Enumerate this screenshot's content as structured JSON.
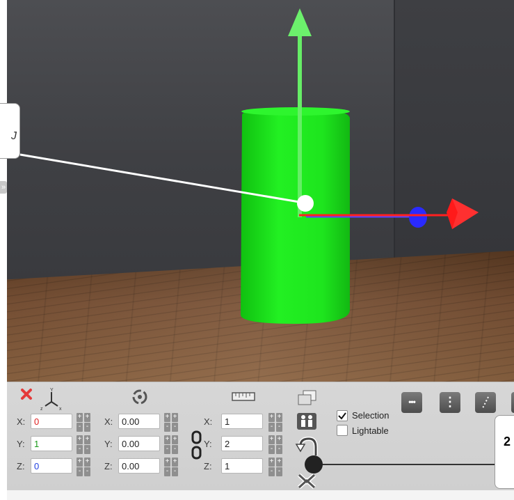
{
  "viewport": {
    "object_color": "#1ee51e",
    "gizmo": {
      "y_axis_color": "#66ff66",
      "x_axis_color": "#ff2020",
      "z_axis_color": "#2a2aff"
    },
    "callout_glyph": "J",
    "panel_toggle_glyph": "»"
  },
  "toolbar": {
    "position": {
      "x_label": "X:",
      "x_value": "0",
      "y_label": "Y:",
      "y_value": "1",
      "z_label": "Z:",
      "z_value": "0",
      "axis_icon_labels": {
        "y": "Y",
        "z": "z",
        "x": "x"
      },
      "x_color": "#e02020",
      "y_color": "#1a9a1a",
      "z_color": "#2040e0"
    },
    "rotation": {
      "x_label": "X:",
      "x_value": "0.00",
      "y_label": "Y:",
      "y_value": "0.00",
      "z_label": "Z:",
      "z_value": "0.00"
    },
    "scale": {
      "x_label": "X:",
      "x_value": "1",
      "y_label": "Y:",
      "y_value": "2",
      "z_label": "Z:",
      "z_value": "1"
    },
    "stepper": {
      "plus": "+",
      "minus": "-"
    },
    "selection_label": "Selection",
    "selection_checked": true,
    "lightable_label": "Lightable",
    "lightable_checked": false,
    "dots_button": "•••",
    "vdots_button": "⋮"
  },
  "info_box_value": "2"
}
